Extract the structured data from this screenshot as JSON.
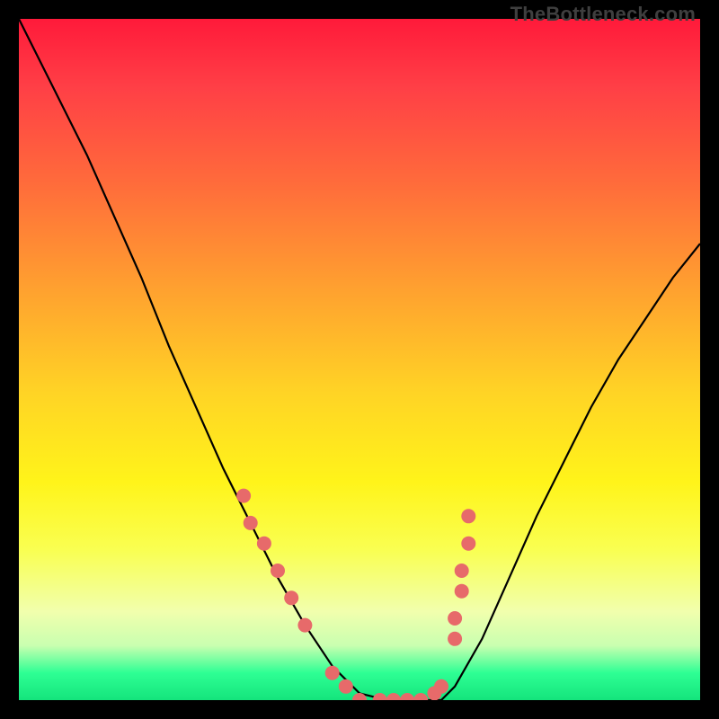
{
  "watermark": "TheBottleneck.com",
  "chart_data": {
    "type": "line",
    "title": "",
    "xlabel": "",
    "ylabel": "",
    "xlim": [
      0,
      100
    ],
    "ylim": [
      0,
      100
    ],
    "grid": false,
    "legend": false,
    "series": [
      {
        "name": "curve",
        "x": [
          0,
          5,
          10,
          14,
          18,
          22,
          26,
          30,
          34,
          38,
          42,
          46,
          50,
          54,
          58,
          62,
          64,
          68,
          72,
          76,
          80,
          84,
          88,
          92,
          96,
          100
        ],
        "y": [
          100,
          90,
          80,
          71,
          62,
          52,
          43,
          34,
          26,
          18,
          11,
          5,
          1,
          0,
          0,
          0,
          2,
          9,
          18,
          27,
          35,
          43,
          50,
          56,
          62,
          67
        ]
      }
    ],
    "markers": [
      {
        "name": "left-cluster",
        "x": [
          33,
          34,
          36,
          38,
          40,
          42,
          46,
          48
        ],
        "y": [
          30,
          26,
          23,
          19,
          15,
          11,
          4,
          2
        ]
      },
      {
        "name": "right-cluster",
        "x": [
          61,
          62,
          64,
          64,
          65,
          65,
          66,
          66
        ],
        "y": [
          1,
          2,
          9,
          12,
          16,
          19,
          23,
          27
        ]
      },
      {
        "name": "valley",
        "x": [
          50,
          53,
          55,
          57,
          59
        ],
        "y": [
          0,
          0,
          0,
          0,
          0
        ]
      }
    ],
    "marker_color": "#e76a6a",
    "curve_color": "#000000"
  }
}
